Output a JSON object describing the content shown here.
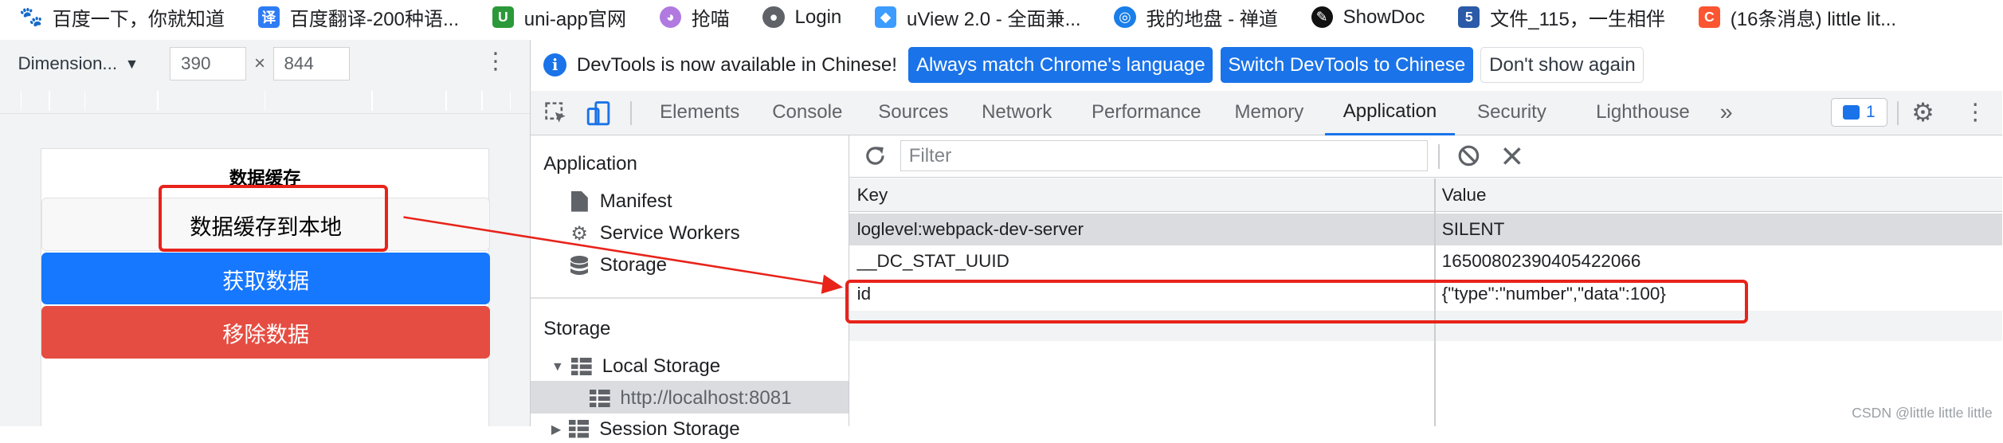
{
  "bookmarks": [
    {
      "label": "百度一下，你就知道",
      "icon": "baidu-paw-icon",
      "color": "#2932e1",
      "glyph": "🐾"
    },
    {
      "label": "百度翻译-200种语...",
      "icon": "baidu-translate-icon",
      "color": "#2d7cf6",
      "glyph": "译"
    },
    {
      "label": "uni-app官网",
      "icon": "uniapp-icon",
      "color": "#2b9939",
      "glyph": "U"
    },
    {
      "label": "抢喵",
      "icon": "cat-icon",
      "color": "#9b59d0",
      "glyph": "◕"
    },
    {
      "label": "Login",
      "icon": "globe-icon",
      "color": "#5f6368",
      "glyph": "🌐"
    },
    {
      "label": "uView 2.0 - 全面兼...",
      "icon": "uview-icon",
      "color": "#3c9cff",
      "glyph": "◆"
    },
    {
      "label": "我的地盘 - 禅道",
      "icon": "zentao-icon",
      "color": "#1a7ee8",
      "glyph": "◎"
    },
    {
      "label": "ShowDoc",
      "icon": "showdoc-icon",
      "color": "#111111",
      "glyph": "✎"
    },
    {
      "label": "文件_115，一生相伴",
      "icon": "file115-icon",
      "color": "#2b5aa8",
      "glyph": "5"
    },
    {
      "label": "(16条消息) little lit...",
      "icon": "csdn-icon",
      "color": "#fc5531",
      "glyph": "C"
    }
  ],
  "device_toolbar": {
    "dimension_label": "Dimension...",
    "width": "390",
    "height": "844",
    "times": "×"
  },
  "phone": {
    "title": "数据缓存",
    "save_button": "数据缓存到本地",
    "get_button": "获取数据",
    "remove_button": "移除数据",
    "colors": {
      "primary": "#1677ff",
      "danger": "#e54d42"
    }
  },
  "infobar": {
    "message": "DevTools is now available in Chinese!",
    "btn_match": "Always match Chrome's language",
    "btn_switch": "Switch DevTools to Chinese",
    "btn_dismiss": "Don't show again"
  },
  "tabs": {
    "elements": "Elements",
    "console": "Console",
    "sources": "Sources",
    "network": "Network",
    "performance": "Performance",
    "memory": "Memory",
    "application": "Application",
    "security": "Security",
    "lighthouse": "Lighthouse",
    "more": "»",
    "issues_count": "1"
  },
  "sidebar": {
    "application_header": "Application",
    "manifest": "Manifest",
    "service_workers": "Service Workers",
    "storage": "Storage",
    "storage_header": "Storage",
    "local_storage": "Local Storage",
    "local_origin": "http://localhost:8081",
    "session_storage": "Session Storage"
  },
  "storage_table": {
    "filter_placeholder": "Filter",
    "col_key": "Key",
    "col_value": "Value",
    "rows": [
      {
        "key": "loglevel:webpack-dev-server",
        "value": "SILENT"
      },
      {
        "key": "__DC_STAT_UUID",
        "value": "16500802390405422066"
      },
      {
        "key": "id",
        "value": "{\"type\":\"number\",\"data\":100}"
      }
    ]
  },
  "watermark": "CSDN @little little little",
  "annotation_color": "#e8231a"
}
